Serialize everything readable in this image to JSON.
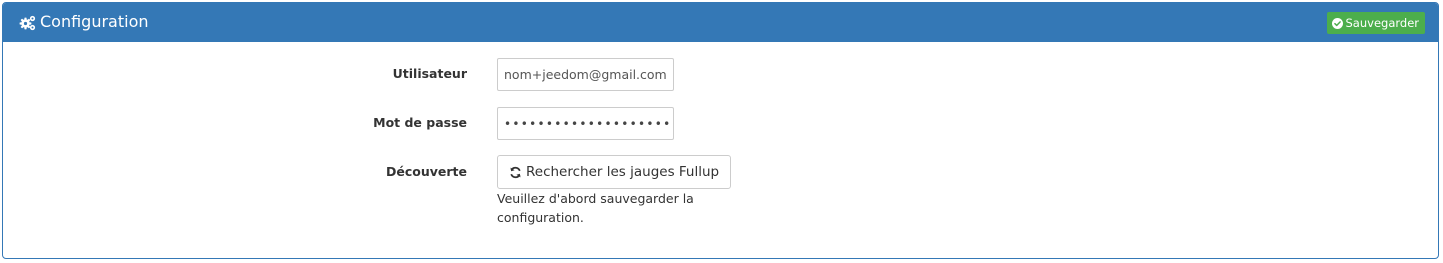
{
  "panel": {
    "title": "Configuration",
    "title_icon": "cogs-icon",
    "save_button": {
      "label": "Sauvegarder",
      "icon": "check-circle-icon"
    }
  },
  "form": {
    "user": {
      "label": "Utilisateur",
      "value": "nom+jeedom@gmail.com"
    },
    "password": {
      "label": "Mot de passe",
      "value": "••••••••••••••••••••"
    },
    "discovery": {
      "label": "Découverte",
      "button_label": "Rechercher les jauges Fullup",
      "button_icon": "refresh-icon",
      "help_text": "Veuillez d'abord sauvegarder la configuration."
    }
  },
  "colors": {
    "header": "#3478b6",
    "save_button": "#4cae4c"
  }
}
